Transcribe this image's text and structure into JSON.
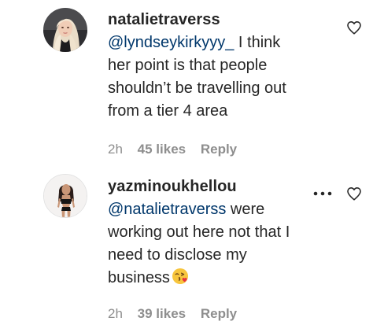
{
  "comments": [
    {
      "username": "natalietraverss",
      "mention": "@lyndseykirkyyy_",
      "text_lines": [
        " I think",
        "her point is that people",
        "shouldn’t be travelling out",
        "from a tier 4 area"
      ],
      "time": "2h",
      "likes": "45 likes",
      "reply_label": "Reply",
      "avatar_icon": "avatar-blonde-woman",
      "heart_icon": "heart-outline-icon"
    },
    {
      "username": "yazminoukhellou",
      "mention": "@natalietraverss",
      "text_lines": [
        " were",
        "working out here not that I",
        "need to disclose my",
        "business"
      ],
      "emoji_icon": "face-blowing-kiss-emoji",
      "time": "2h",
      "likes": "39 likes",
      "reply_label": "Reply",
      "avatar_icon": "avatar-woman-black-outfit",
      "more_icon": "more-options-icon",
      "heart_icon": "heart-outline-icon"
    }
  ],
  "colors": {
    "text": "#262626",
    "mention": "#00376b",
    "meta": "#8e8e8e"
  }
}
